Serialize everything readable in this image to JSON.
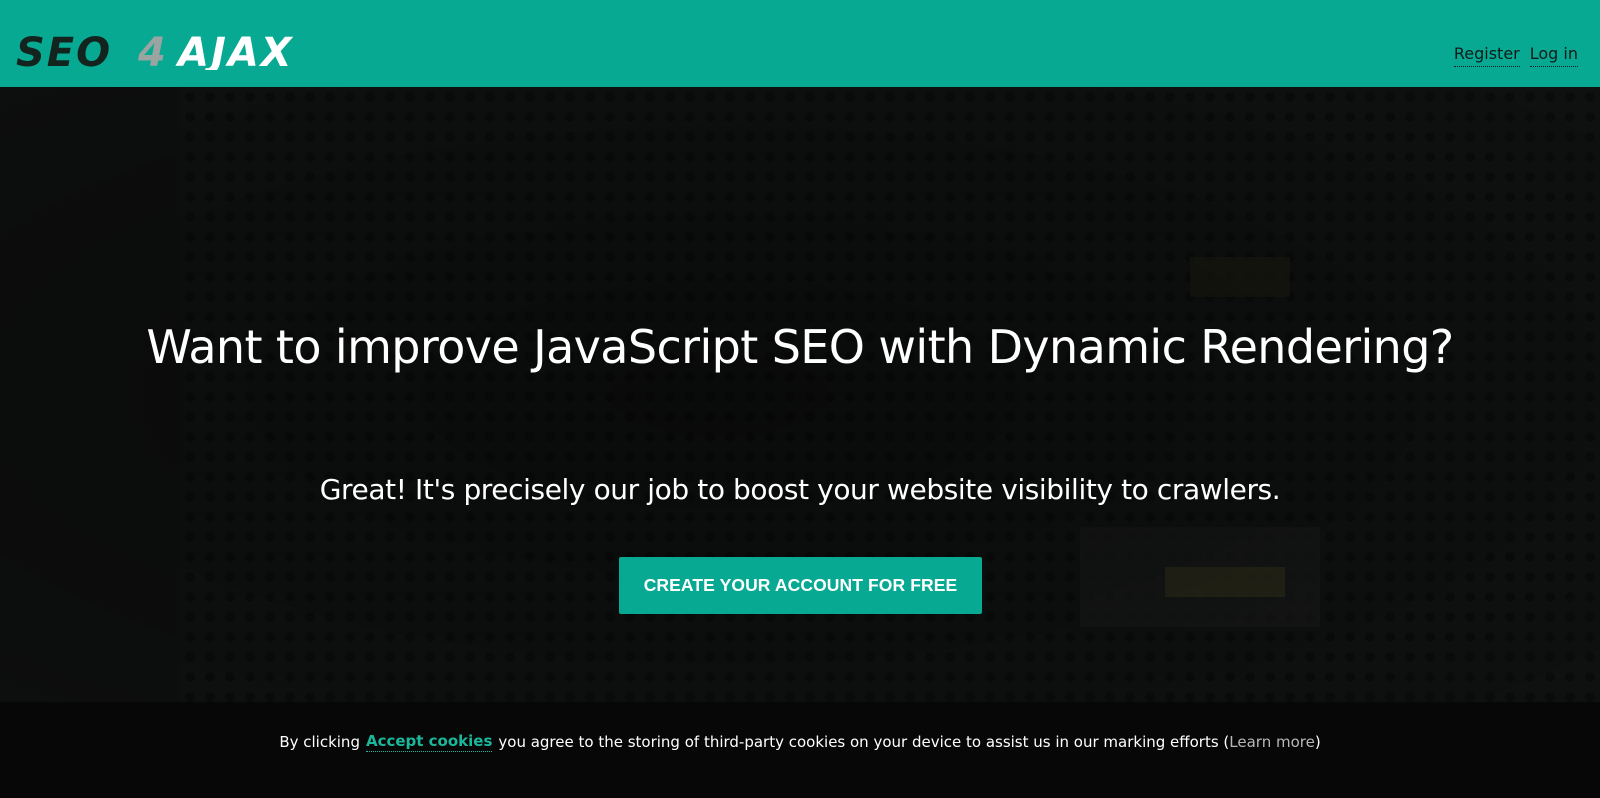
{
  "header": {
    "logo_text": "SEO4AJAX",
    "bg_color": "#08a993",
    "nav": {
      "register_label": "Register",
      "login_label": "Log in"
    }
  },
  "hero": {
    "headline": "Want to improve JavaScript SEO with Dynamic Rendering?",
    "subline": "Great! It's precisely our job to boost your website visibility to crawlers.",
    "cta_label": "CREATE YOUR ACCOUNT FOR FREE",
    "cta_color": "#08a993"
  },
  "cookie_bar": {
    "prefix": "By clicking",
    "accept_label": "Accept cookies",
    "middle": "you agree to the storing of third-party cookies on your device to assist us in our marking efforts (",
    "learn_more_label": "Learn more",
    "suffix": ")",
    "accent_color": "#19b89c"
  }
}
